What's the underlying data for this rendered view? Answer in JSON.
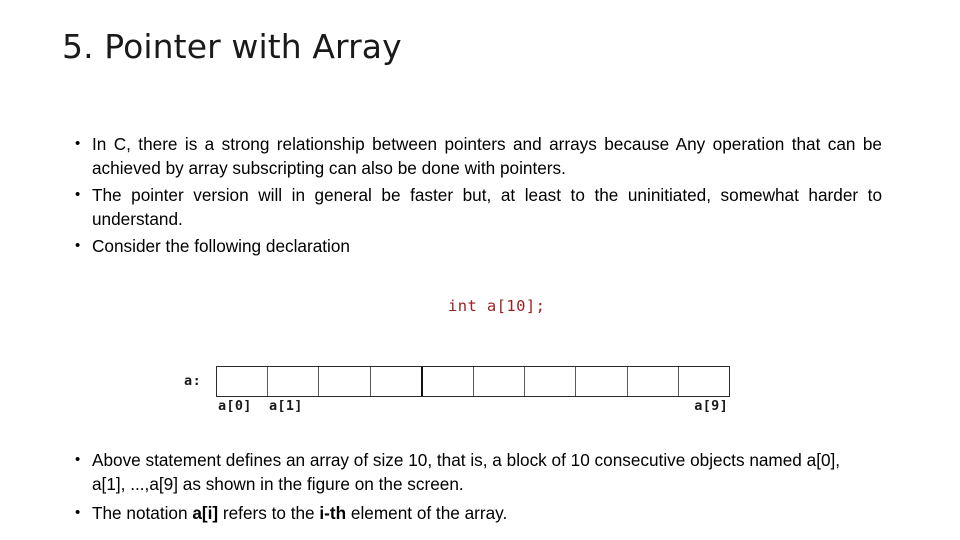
{
  "slide": {
    "title": "5. Pointer with Array",
    "bullets_top": [
      "In C, there is a strong relationship between pointers and arrays because Any operation that can be achieved by array subscripting can also be done with pointers.",
      "The pointer version will in general be faster but, at least to the uninitiated, somewhat harder to understand.",
      "Consider the following declaration"
    ],
    "code": "int a[10];",
    "code_color": "#9e1f22",
    "figure": {
      "variable_label": "a:",
      "cell_count": 10,
      "cell_labels": {
        "first": "a[0]",
        "second": "a[1]",
        "last": "a[9]"
      }
    },
    "bullets_bottom": [
      {
        "parts": [
          {
            "text": "Above statement defines an array of size 10, that is, a block of 10 consecutive objects named a[0], a[1], ...,a[9] as shown in the figure on the screen.",
            "bold": false
          }
        ]
      },
      {
        "parts": [
          {
            "text": "The notation ",
            "bold": false
          },
          {
            "text": "a[i]",
            "bold": true
          },
          {
            "text": " refers to the ",
            "bold": false
          },
          {
            "text": "i-th",
            "bold": true
          },
          {
            "text": " element of the array.",
            "bold": false
          }
        ]
      }
    ]
  }
}
